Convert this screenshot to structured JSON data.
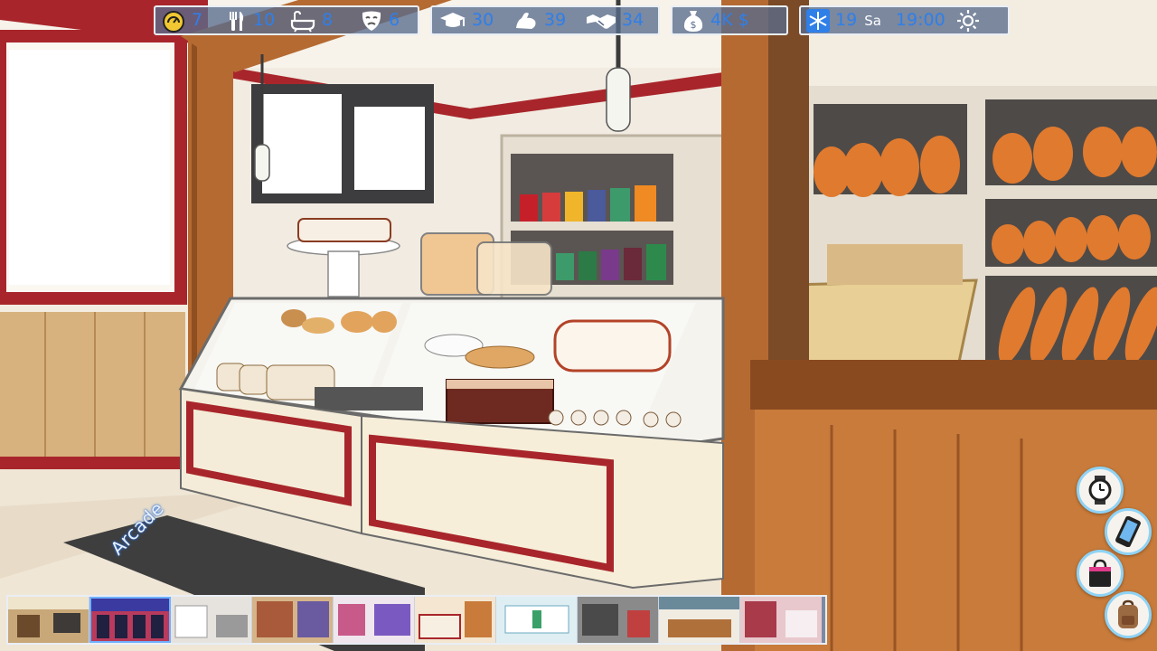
{
  "game": {
    "location": "Arcade",
    "colors": {
      "hud_panel": "#586c8c",
      "hud_value": "#2f7fe9",
      "hud_border": "#e9eef5",
      "accent_red": "#a8262b",
      "wood": "#b56a32"
    }
  },
  "hud": {
    "needs": [
      {
        "name": "energy",
        "icon": "energy-gauge-icon",
        "value": "7"
      },
      {
        "name": "hunger",
        "icon": "fork-knife-icon",
        "value": "10"
      },
      {
        "name": "hygiene",
        "icon": "bathtub-icon",
        "value": "8"
      },
      {
        "name": "mood",
        "icon": "theater-mask-icon",
        "value": "6"
      }
    ],
    "skills": [
      {
        "name": "intelligence",
        "icon": "graduation-cap-icon",
        "value": "30"
      },
      {
        "name": "fitness",
        "icon": "flexed-arm-icon",
        "value": "39"
      },
      {
        "name": "charisma",
        "icon": "handshake-icon",
        "value": "34"
      }
    ],
    "money": {
      "icon": "money-bag-icon",
      "value": "4K $"
    },
    "time": {
      "weather_icon": "snowflake-icon",
      "day": "19",
      "weekday": "Sa",
      "clock": "19:00",
      "sun_icon": "sun-icon"
    }
  },
  "locations": [
    {
      "name": "lobby",
      "active": false
    },
    {
      "name": "arcade",
      "active": true
    },
    {
      "name": "kitchen",
      "active": false
    },
    {
      "name": "bookstore",
      "active": false
    },
    {
      "name": "clothing-store",
      "active": false
    },
    {
      "name": "bakery",
      "active": false
    },
    {
      "name": "pharmacy",
      "active": false
    },
    {
      "name": "gas-station",
      "active": false
    },
    {
      "name": "cafe",
      "active": false
    },
    {
      "name": "club",
      "active": false
    }
  ],
  "side_buttons": [
    {
      "name": "watch-button",
      "icon": "wristwatch-icon"
    },
    {
      "name": "phone-button",
      "icon": "smartphone-icon"
    },
    {
      "name": "shop-button",
      "icon": "shopping-bag-icon"
    },
    {
      "name": "inventory-button",
      "icon": "backpack-icon"
    }
  ]
}
